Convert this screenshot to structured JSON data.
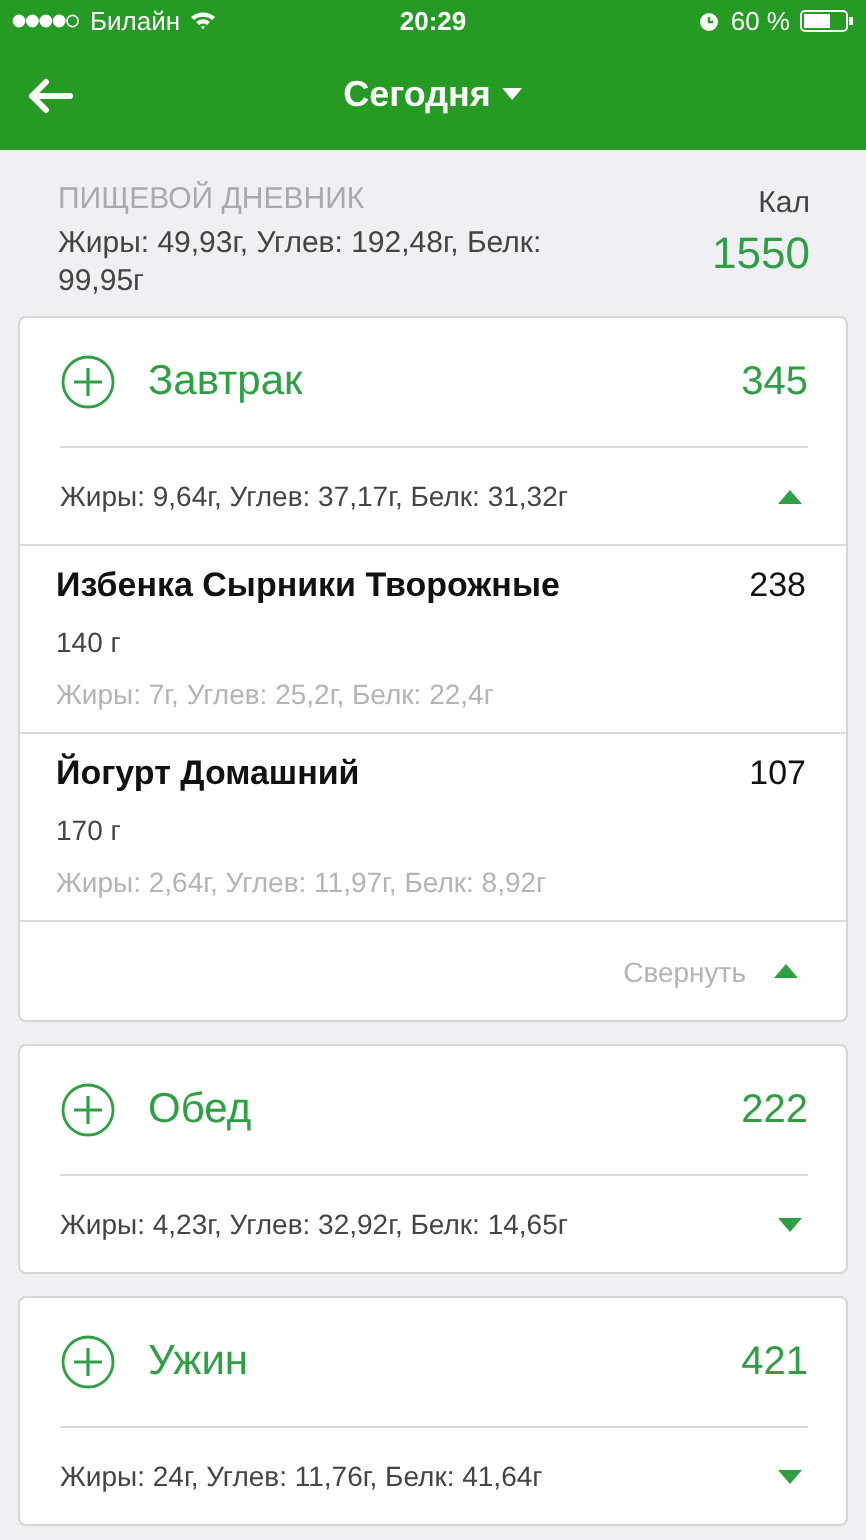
{
  "status_bar": {
    "carrier": "Билайн",
    "time": "20:29",
    "battery": "60 %"
  },
  "nav": {
    "title": "Сегодня"
  },
  "summary": {
    "heading": "ПИЩЕВОЙ ДНЕВНИК",
    "macros": "Жиры: 49,93г, Углев: 192,48г, Белк: 99,95г",
    "calories_label": "Кал",
    "calories": "1550"
  },
  "meals": [
    {
      "name": "Завтрак",
      "calories": "345",
      "macros": "Жиры: 9,64г, Углев: 37,17г, Белк: 31,32г",
      "expanded": true,
      "collapse_label": "Свернуть",
      "items": [
        {
          "name": "Избенка Сырники Творожные",
          "calories": "238",
          "amount": "140 г",
          "macros": "Жиры: 7г, Углев: 25,2г, Белк: 22,4г"
        },
        {
          "name": "Йогурт Домашний",
          "calories": "107",
          "amount": "170 г",
          "macros": "Жиры: 2,64г, Углев: 11,97г, Белк: 8,92г"
        }
      ]
    },
    {
      "name": "Обед",
      "calories": "222",
      "macros": "Жиры: 4,23г, Углев: 32,92г, Белк: 14,65г",
      "expanded": false
    },
    {
      "name": "Ужин",
      "calories": "421",
      "macros": "Жиры: 24г, Углев: 11,76г, Белк: 41,64г",
      "expanded": false
    }
  ]
}
